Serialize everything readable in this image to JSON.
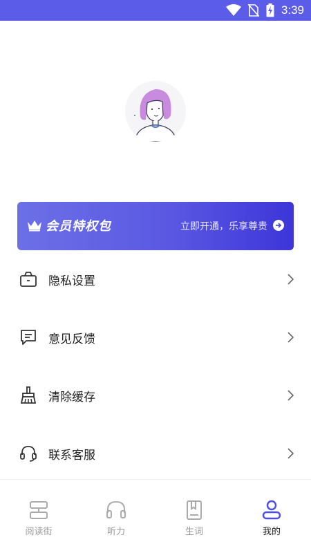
{
  "status_bar": {
    "time": "3:39",
    "icons": [
      "wifi-icon",
      "no-sim-icon",
      "battery-charging-icon"
    ]
  },
  "profile": {
    "avatar": "avatar-illustration"
  },
  "vip_banner": {
    "title": "会员特权包",
    "cta": "立即开通，乐享尊贵"
  },
  "menu": {
    "items": [
      {
        "label": "隐私设置",
        "icon": "briefcase-icon"
      },
      {
        "label": "意见反馈",
        "icon": "feedback-icon"
      },
      {
        "label": "清除缓存",
        "icon": "broom-icon"
      },
      {
        "label": "联系客服",
        "icon": "headset-icon"
      }
    ]
  },
  "tabbar": {
    "tabs": [
      {
        "label": "阅读街",
        "icon": "reading-street-icon",
        "active": false
      },
      {
        "label": "听力",
        "icon": "headphones-icon",
        "active": false
      },
      {
        "label": "生词",
        "icon": "vocabulary-book-icon",
        "active": false
      },
      {
        "label": "我的",
        "icon": "profile-icon",
        "active": true
      }
    ]
  },
  "colors": {
    "accent": "#5b5ce8",
    "active_tab": "#4b4de6",
    "inactive": "#9a9a9a"
  }
}
